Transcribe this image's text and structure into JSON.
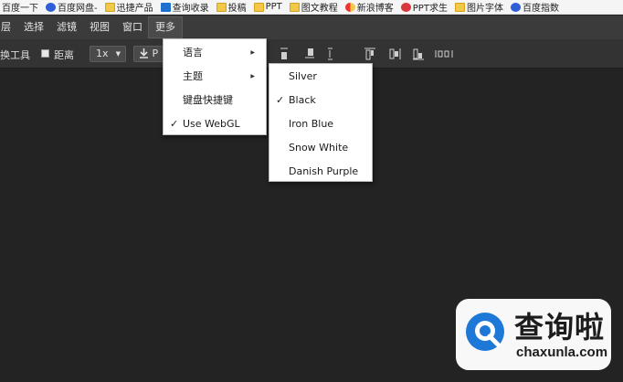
{
  "bookmarks": [
    {
      "label": "百度一下",
      "icon": "paw-icon"
    },
    {
      "label": "百度网盘-",
      "icon": "paw-icon"
    },
    {
      "label": "迅捷产品",
      "icon": "folder-icon"
    },
    {
      "label": "查询收录",
      "icon": "j-icon"
    },
    {
      "label": "投稿",
      "icon": "folder-icon"
    },
    {
      "label": "PPT",
      "icon": "folder-icon"
    },
    {
      "label": "图文教程",
      "icon": "folder-icon"
    },
    {
      "label": "新浪博客",
      "icon": "weibo-icon"
    },
    {
      "label": "PPT求生",
      "icon": "ppt-icon"
    },
    {
      "label": "图片字体",
      "icon": "folder-icon"
    },
    {
      "label": "百度指数",
      "icon": "paw-icon"
    }
  ],
  "menubar": {
    "items": [
      "层",
      "选择",
      "滤镜",
      "视图",
      "窗口",
      "更多"
    ],
    "active": "更多"
  },
  "toolbar": {
    "transform_label": "换工具",
    "distance_label": "距离",
    "zoom_value": "1x",
    "export_label": "P"
  },
  "more_menu": {
    "items": [
      {
        "label": "语言",
        "has_submenu": true,
        "checked": false
      },
      {
        "label": "主题",
        "has_submenu": true,
        "checked": false
      },
      {
        "label": "键盘快捷键",
        "has_submenu": false,
        "checked": false
      },
      {
        "label": "Use WebGL",
        "has_submenu": false,
        "checked": true
      }
    ]
  },
  "theme_submenu": {
    "items": [
      {
        "label": "Silver",
        "checked": false
      },
      {
        "label": "Black",
        "checked": true
      },
      {
        "label": "Iron Blue",
        "checked": false
      },
      {
        "label": "Snow White",
        "checked": false
      },
      {
        "label": "Danish Purple",
        "checked": false
      }
    ],
    "check_glyph": "✓"
  },
  "watermark": {
    "cn": "查询啦",
    "en": "chaxunla.com"
  },
  "colors": {
    "canvas": "#232323",
    "menubar": "#3b3b3b",
    "toolbar": "#333333",
    "watermark_blue": "#1e78d7"
  }
}
